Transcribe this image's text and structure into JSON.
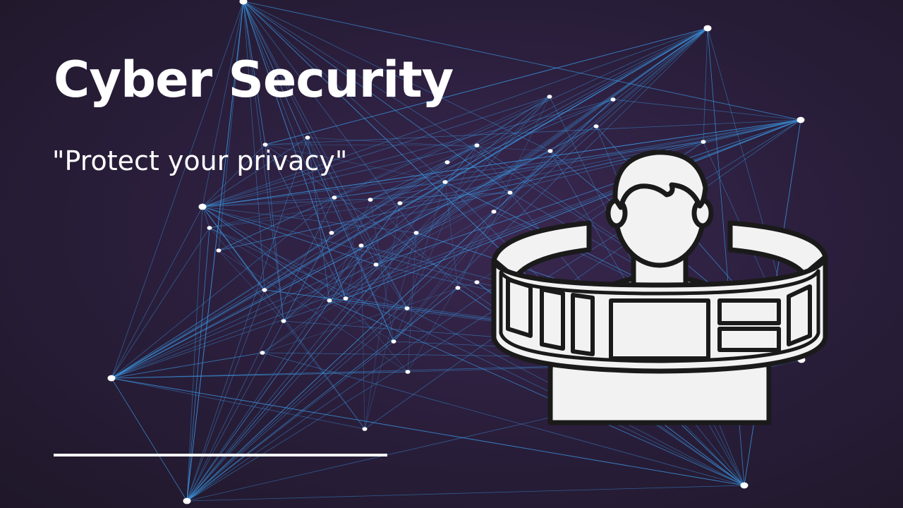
{
  "slide": {
    "title": "Cyber Security",
    "subtitle": "\"Protect your privacy\""
  },
  "colors": {
    "background": "#2b1f3d",
    "network_line": "#3a8fd8",
    "node": "#ffffff",
    "text": "#ffffff",
    "illustration_fill": "#f2f2f2",
    "illustration_stroke": "#1a1a1a"
  },
  "icons": {
    "background": "network-graph-icon",
    "illustration": "person-surrounded-by-screens-icon"
  }
}
